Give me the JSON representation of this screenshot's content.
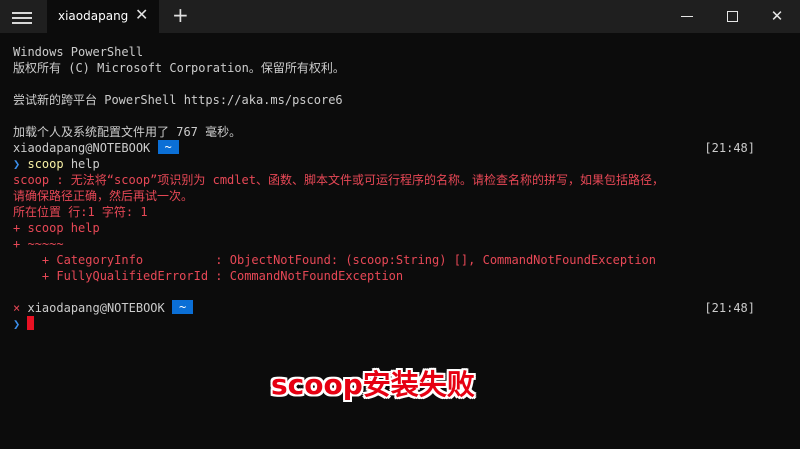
{
  "titlebar": {
    "tab_label": "xiaodapang",
    "tab_close": "✕",
    "new_tab": "+",
    "win_close": "✕"
  },
  "terminal": {
    "l1": "Windows PowerShell",
    "l2": "版权所有 (C) Microsoft Corporation。保留所有权利。",
    "l3": "尝试新的跨平台 PowerShell https://aka.ms/pscore6",
    "l4": "加载个人及系统配置文件用了 767 毫秒。",
    "prompt_user": "xiaodapang@NOTEBOOK",
    "prompt_dir": "~",
    "time1": "[21:48]",
    "cmd_arrow": "❯",
    "cmd_name": "scoop",
    "cmd_args": " help",
    "err1": "scoop : 无法将“scoop”项识别为 cmdlet、函数、脚本文件或可运行程序的名称。请检查名称的拼写，如果包括路径，",
    "err2": "请确保路径正确，然后再试一次。",
    "err3": "所在位置 行:1 字符: 1",
    "err4": "+ scoop help",
    "err5": "+ ~~~~~",
    "err6": "    + CategoryInfo          : ObjectNotFound: (scoop:String) [], CommandNotFoundException",
    "err7": "    + FullyQualifiedErrorId : CommandNotFoundException",
    "fail_mark": "×",
    "time2": "[21:48]"
  },
  "overlay": {
    "caption": "scoop安装失败"
  }
}
